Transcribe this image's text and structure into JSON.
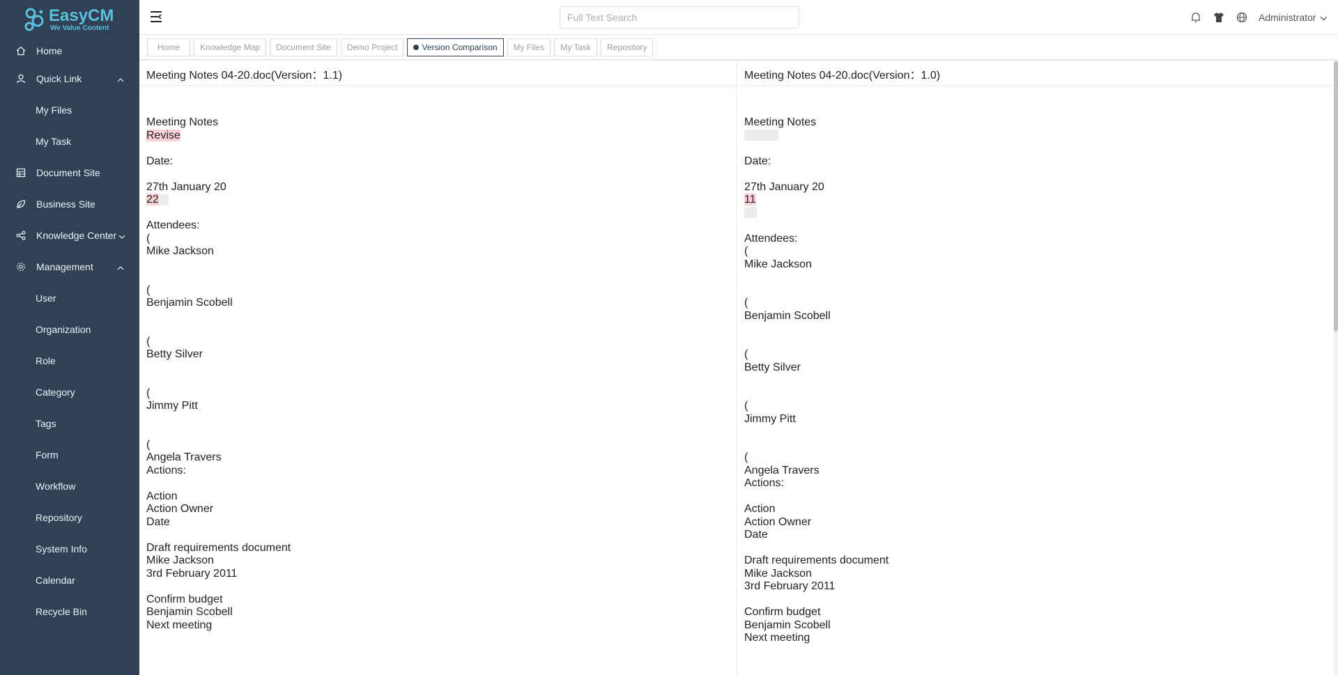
{
  "app": {
    "brand_name": "EasyCM",
    "brand_tagline": "We Value Content",
    "accent_color": "#5bc0de",
    "sidebar_color": "#304156",
    "highlight_color": "#f8d0d6"
  },
  "sidebar": {
    "home": "Home",
    "quick_link": "Quick Link",
    "my_files": "My Files",
    "my_task": "My Task",
    "document_site": "Document Site",
    "business_site": "Business Site",
    "knowledge_center": "Knowledge Center",
    "management": "Management",
    "user": "User",
    "organization": "Organization",
    "role": "Role",
    "category": "Category",
    "tags": "Tags",
    "form": "Form",
    "workflow": "Workflow",
    "repository": "Repository",
    "system_info": "System Info",
    "calendar": "Calendar",
    "recycle_bin": "Recycle Bin"
  },
  "header": {
    "search_placeholder": "Full Text Search",
    "user_name": "Administrator"
  },
  "tabs": {
    "home": "Home",
    "knowledge_map": "Knowledge Map",
    "document_site": "Document Site",
    "demo_project": "Demo Project",
    "version_comparison": "Version Comparison",
    "my_files": "My Files",
    "my_task": "My Task",
    "repository": "Repository"
  },
  "compare": {
    "left_title": "Meeting Notes 04-20.doc(Version：1.1)",
    "right_title": "Meeting Notes 04-20.doc(Version：1.0)",
    "left": {
      "heading": "Meeting Notes",
      "revise": "Revise",
      "date_label": "Date:",
      "date_value": "27th January 20",
      "date_changed": "22",
      "attendees_label": "Attendees:",
      "paren": "(",
      "a1": "Mike Jackson",
      "a2": "Benjamin Scobell",
      "a3": "Betty Silver",
      "a4": "Jimmy Pitt",
      "a5": "Angela Travers",
      "actions_label": "Actions:",
      "col_action": "Action",
      "col_owner": "Action Owner",
      "col_date": "Date",
      "r1_action": "Draft requirements document",
      "r1_owner": "Mike Jackson",
      "r1_date": "3rd February 2011",
      "r2_action": "Confirm budget",
      "r2_owner": "Benjamin Scobell",
      "r3_action": "Next meeting"
    },
    "right": {
      "heading": "Meeting Notes",
      "date_label": "Date:",
      "date_value": "27th January 20",
      "date_changed": "11",
      "attendees_label": "Attendees:",
      "paren": "(",
      "a1": "Mike Jackson",
      "a2": "Benjamin Scobell",
      "a3": "Betty Silver",
      "a4": "Jimmy Pitt",
      "a5": "Angela Travers",
      "actions_label": "Actions:",
      "col_action": "Action",
      "col_owner": "Action Owner",
      "col_date": "Date",
      "r1_action": "Draft requirements document",
      "r1_owner": "Mike Jackson",
      "r1_date": "3rd February 2011",
      "r2_action": "Confirm budget",
      "r2_owner": "Benjamin Scobell",
      "r3_action": "Next meeting"
    }
  }
}
